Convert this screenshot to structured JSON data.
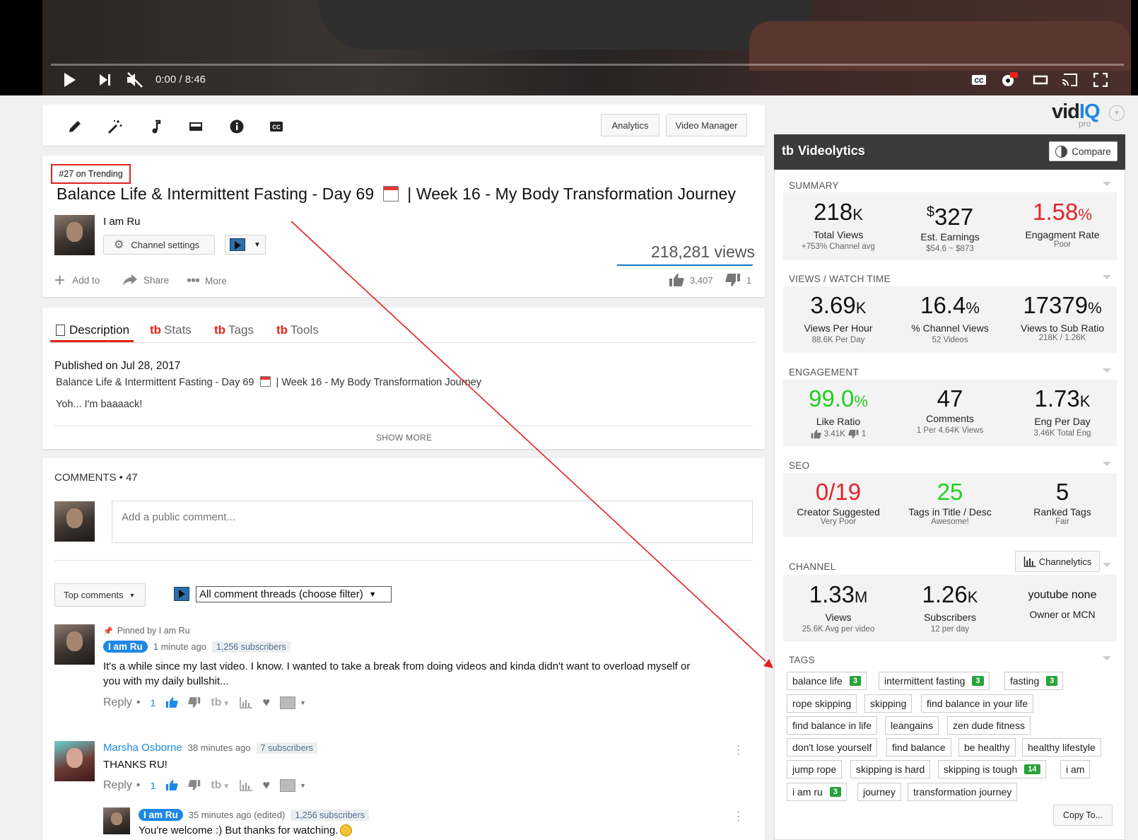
{
  "player": {
    "time": "0:00 / 8:46"
  },
  "toolbar": {
    "analytics_label": "Analytics",
    "video_manager_label": "Video Manager"
  },
  "video": {
    "trending_badge": "#27 on Trending",
    "title_part1": "Balance Life & Intermittent Fasting - Day 69",
    "title_part2": "| Week 16 - My Body Transformation Journey",
    "channel_name": "I am Ru",
    "channel_settings_label": "Channel settings",
    "views": "218,281 views",
    "add_to_label": "Add to",
    "share_label": "Share",
    "more_label": "More",
    "likes": "3,407",
    "dislikes": "1"
  },
  "tabs": [
    {
      "label": "Description"
    },
    {
      "label": "Stats"
    },
    {
      "label": "Tags"
    },
    {
      "label": "Tools"
    }
  ],
  "description": {
    "published": "Published on Jul 28, 2017",
    "line1_part1": "Balance Life & Intermittent Fasting - Day 69",
    "line1_part2": "| Week 16 - My Body Transformation Journey",
    "line2": "Yoh... I'm baaaack!",
    "show_more": "SHOW MORE"
  },
  "comments": {
    "header": "COMMENTS • 47",
    "placeholder": "Add a public comment...",
    "sort_label": "Top comments",
    "filter_label": "All comment threads (choose filter)",
    "items": [
      {
        "pinned_label": "Pinned by I am Ru",
        "author": "I am Ru",
        "time": "1 minute ago",
        "subscribers": "1,256 subscribers",
        "text1": "It's a while since my last video. I know. I wanted to take a break from doing videos and kinda didn't want to overload myself or",
        "text2": "you with my daily bullshit...",
        "reply_label": "Reply",
        "likes": "1"
      },
      {
        "author": "Marsha Osborne",
        "time": "38 minutes ago",
        "subscribers": "7 subscribers",
        "text1": "THANKS RU!",
        "reply_label": "Reply",
        "likes": "1"
      },
      {
        "author": "I am Ru",
        "time": "35 minutes ago (edited)",
        "subscribers": "1,256 subscribers",
        "text1": "You're welcome :) But thanks for watching."
      }
    ]
  },
  "vidiq": {
    "logo_main": "vid",
    "logo_iq": "IQ",
    "logo_pro": "pro",
    "panel_title": "Videolytics",
    "compare_label": "Compare",
    "summary": {
      "title": "SUMMARY",
      "total_views": "218",
      "total_views_unit": "K",
      "total_views_label": "Total Views",
      "total_views_sub": "+753% Channel avg",
      "earnings_currency": "$",
      "earnings": "327",
      "earnings_label": "Est. Earnings",
      "earnings_sub": "$54.6 ~ $873",
      "engagement_rate": "1.58",
      "engagement_rate_unit": "%",
      "engagement_rate_label": "Engagment Rate",
      "engagement_rate_sub": "Poor"
    },
    "views_watch": {
      "title": "VIEWS / WATCH TIME",
      "vph": "3.69",
      "vph_unit": "K",
      "vph_label": "Views Per Hour",
      "vph_sub": "88.6K Per Day",
      "channel_views": "16.4",
      "channel_views_unit": "%",
      "channel_views_label": "% Channel Views",
      "channel_views_sub": "52  Videos",
      "sub_ratio": "17379",
      "sub_ratio_unit": "%",
      "sub_ratio_label": "Views to Sub Ratio",
      "sub_ratio_sub": "218K / 1.26K"
    },
    "engagement": {
      "title": "ENGAGEMENT",
      "like_ratio": "99.0",
      "like_ratio_unit": "%",
      "like_ratio_label": "Like Ratio",
      "like_count": "3.41K",
      "dislike_count": "1",
      "comments": "47",
      "comments_label": "Comments",
      "comments_sub": "1 Per 4.64K Views",
      "eng_per_day": "1.73",
      "eng_per_day_unit": "K",
      "eng_per_day_label": "Eng Per Day",
      "eng_per_day_sub": "3.46K Total Eng"
    },
    "seo": {
      "title": "SEO",
      "creator_suggested": "0/19",
      "creator_suggested_label": "Creator Suggested",
      "creator_suggested_sub": "Very Poor",
      "tags_in_title": "25",
      "tags_in_title_label": "Tags in Title / Desc",
      "tags_in_title_sub": "Awesome!",
      "ranked_tags": "5",
      "ranked_tags_label": "Ranked Tags",
      "ranked_tags_sub": "Fair"
    },
    "channel": {
      "title": "CHANNEL",
      "channelytics_label": "Channelytics",
      "views": "1.33",
      "views_unit": "M",
      "views_label": "Views",
      "views_sub": "25.6K Avg per video",
      "subscribers": "1.26",
      "subscribers_unit": "K",
      "subscribers_label": "Subscribers",
      "subscribers_sub": "12 per day",
      "network": "youtube none",
      "network_label": "Owner or MCN"
    },
    "tags": {
      "title": "TAGS",
      "copy_label": "Copy To...",
      "items": [
        {
          "text": "balance life",
          "count": "3"
        },
        {
          "text": "intermittent fasting",
          "count": "3"
        },
        {
          "text": "fasting",
          "count": "3"
        },
        {
          "text": "rope skipping",
          "count": ""
        },
        {
          "text": "skipping",
          "count": ""
        },
        {
          "text": "find balance in your life",
          "count": ""
        },
        {
          "text": "find balance in life",
          "count": ""
        },
        {
          "text": "leangains",
          "count": ""
        },
        {
          "text": "zen dude fitness",
          "count": ""
        },
        {
          "text": "don't lose yourself",
          "count": ""
        },
        {
          "text": "find balance",
          "count": ""
        },
        {
          "text": "be healthy",
          "count": ""
        },
        {
          "text": "healthy lifestyle",
          "count": ""
        },
        {
          "text": "jump rope",
          "count": ""
        },
        {
          "text": "skipping is hard",
          "count": ""
        },
        {
          "text": "skipping is tough",
          "count": "14"
        },
        {
          "text": "i am",
          "count": ""
        },
        {
          "text": "i am ru",
          "count": "3"
        },
        {
          "text": "journey",
          "count": ""
        },
        {
          "text": "transformation journey",
          "count": ""
        }
      ]
    }
  }
}
